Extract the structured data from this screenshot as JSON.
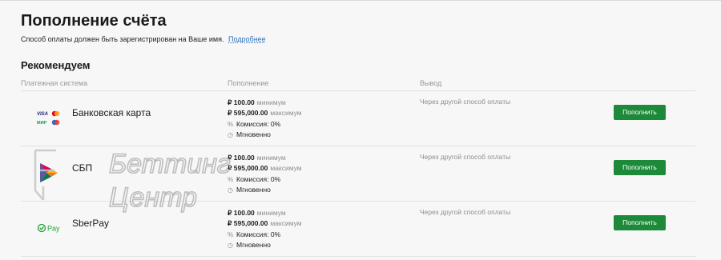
{
  "page": {
    "title": "Пополнение счёта",
    "subtitle": "Способ оплаты должен быть зарегистрирован на Ваше имя.",
    "details_link": "Подробнее"
  },
  "section": {
    "title": "Рекомендуем",
    "col_system": "Платежная система",
    "col_deposit": "Пополнение",
    "col_withdraw": "Вывод"
  },
  "methods": [
    {
      "name": "Банковская карта",
      "min_amount": "₽ 100.00",
      "min_label": "минимум",
      "max_amount": "₽ 595,000.00",
      "max_label": "максимум",
      "commission": "Комиссия: 0%",
      "speed": "Мгновенно",
      "withdraw": "Через другой способ оплаты",
      "button": "Пополнить",
      "icon": "card-brands-icon"
    },
    {
      "name": "СБП",
      "min_amount": "₽ 100.00",
      "min_label": "минимум",
      "max_amount": "₽ 595,000.00",
      "max_label": "максимум",
      "commission": "Комиссия: 0%",
      "speed": "Мгновенно",
      "withdraw": "Через другой способ оплаты",
      "button": "Пополнить",
      "icon": "sbp-icon"
    },
    {
      "name": "SberPay",
      "min_amount": "₽ 100.00",
      "min_label": "минимум",
      "max_amount": "₽ 595,000.00",
      "max_label": "максимум",
      "commission": "Комиссия: 0%",
      "speed": "Мгновенно",
      "withdraw": "Через другой способ оплаты",
      "button": "Пополнить",
      "icon": "sberpay-icon",
      "icon_text": "Pay"
    }
  ],
  "card_logos": {
    "visa": "VISA",
    "mir": "МИР"
  },
  "watermark": {
    "line1": "Беттинг",
    "line2": "Центр"
  },
  "colors": {
    "button": "#1d8a3a",
    "link": "#2a6fb5",
    "sber": "#21a038"
  }
}
